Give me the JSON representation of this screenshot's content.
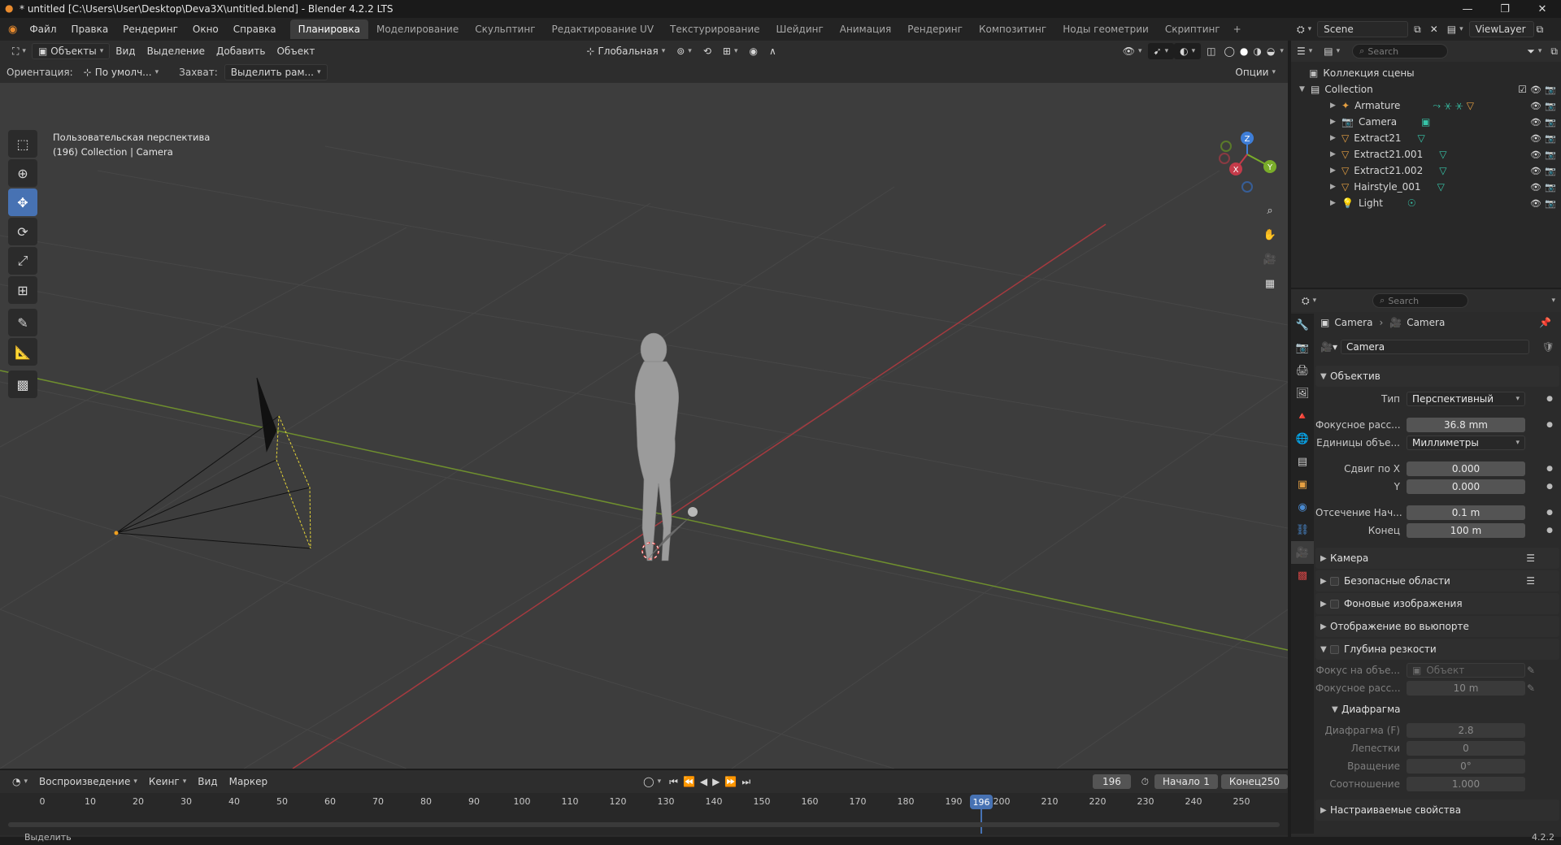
{
  "window": {
    "title": "* untitled [C:\\Users\\User\\Desktop\\Deva3X\\untitled.blend] - Blender 4.2.2 LTS"
  },
  "menu": [
    "Файл",
    "Правка",
    "Рендеринг",
    "Окно",
    "Справка"
  ],
  "workspaces": [
    "Планировка",
    "Моделирование",
    "Скульптинг",
    "Редактирование UV",
    "Текстурирование",
    "Шейдинг",
    "Анимация",
    "Рендеринг",
    "Композитинг",
    "Ноды геометрии",
    "Скриптинг"
  ],
  "workspace_active": 0,
  "scene": {
    "name": "Scene",
    "view_layer": "ViewLayer"
  },
  "viewport": {
    "mode": "Объекты",
    "menus": [
      "Вид",
      "Выделение",
      "Добавить",
      "Объект"
    ],
    "transform": "Глобальная",
    "orientation_label": "Ориентация:",
    "orientation_value": "По умолч...",
    "snap_label": "Захват:",
    "snap_value": "Выделить рам...",
    "options": "Опции",
    "info_line1": "Пользовательская перспектива",
    "info_line2": "(196) Collection | Camera",
    "gizmo": {
      "x": "X",
      "y": "Y",
      "z": "Z"
    }
  },
  "outliner": {
    "search_placeholder": "Search",
    "scene_collection": "Коллекция сцены",
    "collection": "Collection",
    "items": [
      {
        "name": "Armature",
        "color": "#e6a042"
      },
      {
        "name": "Camera",
        "color": "#e6a042"
      },
      {
        "name": "Extract21",
        "color": "#e6a042"
      },
      {
        "name": "Extract21.001",
        "color": "#e6a042"
      },
      {
        "name": "Extract21.002",
        "color": "#e6a042"
      },
      {
        "name": "Hairstyle_001",
        "color": "#e6a042"
      },
      {
        "name": "Light",
        "color": "#e6a042"
      }
    ]
  },
  "properties": {
    "search_placeholder": "Search",
    "breadcrumb": [
      "Camera",
      "Camera"
    ],
    "datablock": "Camera",
    "lens_section": "Объектив",
    "type_label": "Тип",
    "type_value": "Перспективный",
    "focal_label": "Фокусное расс...",
    "focal_value": "36.8 mm",
    "units_label": "Единицы объе...",
    "units_value": "Миллиметры",
    "shiftx_label": "Сдвиг по X",
    "shiftx_value": "0.000",
    "shifty_label": "Y",
    "shifty_value": "0.000",
    "clip_start_label": "Отсечение Нач...",
    "clip_start_value": "0.1 m",
    "clip_end_label": "Конец",
    "clip_end_value": "100 m",
    "camera_section": "Камера",
    "safe_areas": "Безопасные области",
    "bg_images": "Фоновые изображения",
    "viewport_display": "Отображение во вьюпорте",
    "dof": "Глубина резкости",
    "focus_obj_label": "Фокус на объе...",
    "focus_obj_value": "Объект",
    "focus_dist_label": "Фокусное расс...",
    "focus_dist_value": "10 m",
    "aperture": "Диафрагма",
    "fstop_label": "Диафрагма (F)",
    "fstop_value": "2.8",
    "blades_label": "Лепестки",
    "blades_value": "0",
    "rotation_label": "Вращение",
    "rotation_value": "0°",
    "ratio_label": "Соотношение",
    "ratio_value": "1.000",
    "custom_props": "Настраиваемые свойства"
  },
  "timeline": {
    "playback": "Воспроизведение",
    "keying": "Кеинг",
    "view": "Вид",
    "marker": "Маркер",
    "current_frame": "196",
    "start_label": "Начало",
    "start_value": "1",
    "end_label": "Конец",
    "end_value": "250",
    "ticks": [
      "0",
      "10",
      "20",
      "30",
      "40",
      "50",
      "60",
      "70",
      "80",
      "90",
      "100",
      "110",
      "120",
      "130",
      "140",
      "150",
      "160",
      "170",
      "180",
      "190",
      "200",
      "210",
      "220",
      "230",
      "240",
      "250"
    ]
  },
  "status": {
    "left": "Выделить",
    "version": "4.2.2"
  }
}
